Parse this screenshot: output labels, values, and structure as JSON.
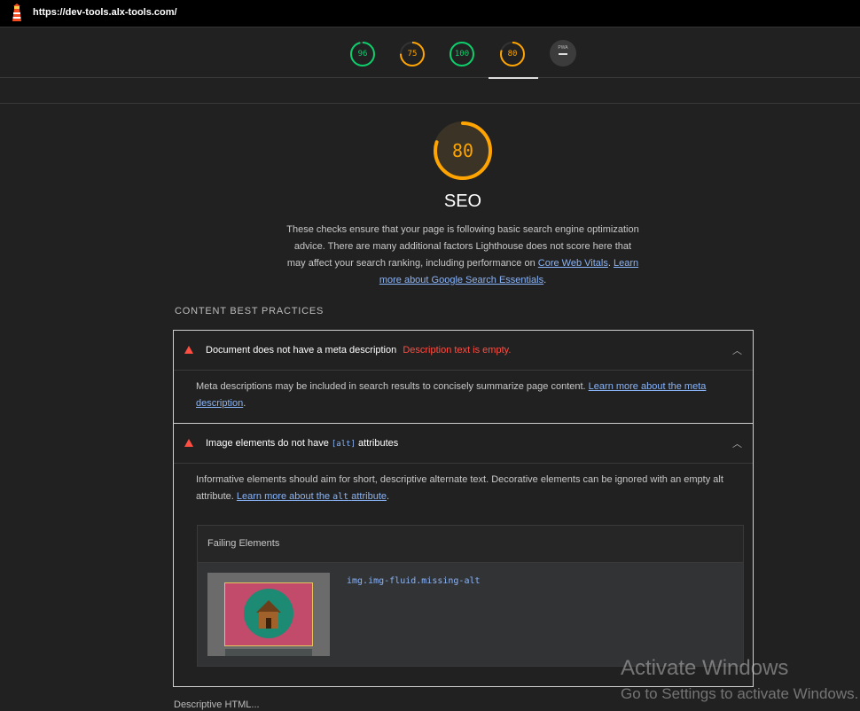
{
  "browser": {
    "url": "https://dev-tools.alx-tools.com/"
  },
  "colors": {
    "pass": "#0cce6b",
    "average": "#ffa400",
    "fail": "#ff4e42",
    "link": "#8ab4f8"
  },
  "gauges": [
    {
      "score": "96",
      "level": 0.96,
      "color": "#0cce6b"
    },
    {
      "score": "75",
      "level": 0.75,
      "color": "#ffa400"
    },
    {
      "score": "100",
      "level": 1.0,
      "color": "#0cce6b"
    },
    {
      "score": "80",
      "level": 0.8,
      "color": "#ffa400",
      "active": true
    }
  ],
  "pwa": {
    "label": "PWA",
    "value": "—"
  },
  "category": {
    "score": "80",
    "level": 0.8,
    "title": "SEO",
    "description": "These checks ensure that your page is following basic search engine optimization advice. There are many additional factors Lighthouse does not score here that may affect your search ranking, including performance on",
    "link1": "Core Web Vitals",
    "link2": "Learn more about Google Search Essentials"
  },
  "group": {
    "title": "CONTENT BEST PRACTICES"
  },
  "audits": [
    {
      "title": "Document does not have a meta description",
      "error": "Description text is empty.",
      "description": "Meta descriptions may be included in search results to concisely summarize page content.",
      "link": "Learn more about the meta description"
    },
    {
      "title_pre": "Image elements do not have",
      "title_code": "[alt]",
      "title_post": "attributes",
      "description": "Informative elements should aim for short, descriptive alternate text. Decorative elements can be ignored with an empty alt attribute.",
      "link_pre": "Learn more about the",
      "link_code": "alt",
      "link_post": "attribute",
      "failing": {
        "header": "Failing Elements",
        "selector": "img.img-fluid.missing-alt"
      }
    }
  ],
  "watermark": {
    "line1": "Activate Windows",
    "line2": "Go to Settings to activate Windows."
  },
  "footer_partial": "Descriptive HTML..."
}
